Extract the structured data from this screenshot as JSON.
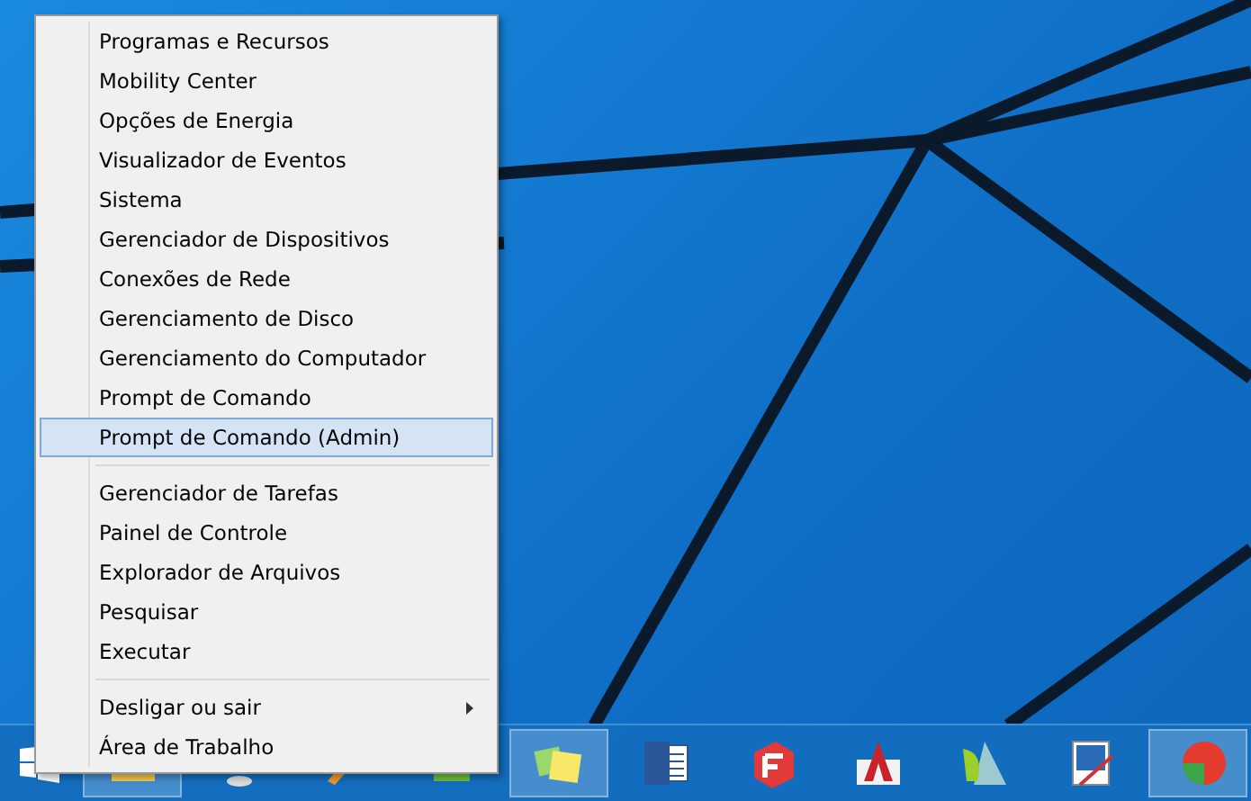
{
  "context_menu": {
    "groups": [
      {
        "items": [
          {
            "label": "Programas e Recursos",
            "selected": false
          },
          {
            "label": "Mobility Center",
            "selected": false
          },
          {
            "label": "Opções de Energia",
            "selected": false
          },
          {
            "label": "Visualizador de Eventos",
            "selected": false
          },
          {
            "label": "Sistema",
            "selected": false
          },
          {
            "label": "Gerenciador de Dispositivos",
            "selected": false
          },
          {
            "label": "Conexões de Rede",
            "selected": false
          },
          {
            "label": "Gerenciamento de Disco",
            "selected": false
          },
          {
            "label": "Gerenciamento do Computador",
            "selected": false
          },
          {
            "label": "Prompt de Comando",
            "selected": false
          },
          {
            "label": "Prompt de Comando (Admin)",
            "selected": true
          }
        ]
      },
      {
        "items": [
          {
            "label": "Gerenciador de Tarefas",
            "selected": false
          },
          {
            "label": "Painel de Controle",
            "selected": false
          },
          {
            "label": "Explorador de Arquivos",
            "selected": false
          },
          {
            "label": "Pesquisar",
            "selected": false
          },
          {
            "label": "Executar",
            "selected": false
          }
        ]
      },
      {
        "items": [
          {
            "label": "Desligar ou sair",
            "selected": false,
            "submenu": true
          },
          {
            "label": "Área de Trabalho",
            "selected": false
          }
        ]
      }
    ]
  },
  "taskbar": {
    "apps": [
      {
        "kind": "explorer",
        "running": true
      },
      {
        "kind": "network",
        "running": false
      },
      {
        "kind": "paint",
        "running": false
      },
      {
        "kind": "store",
        "running": false
      },
      {
        "kind": "notes",
        "running": true
      },
      {
        "kind": "word",
        "running": false
      },
      {
        "kind": "sketch",
        "running": false
      },
      {
        "kind": "cad",
        "running": false
      },
      {
        "kind": "ds",
        "running": false
      },
      {
        "kind": "screen",
        "running": false
      },
      {
        "kind": "browser",
        "running": true
      }
    ]
  }
}
